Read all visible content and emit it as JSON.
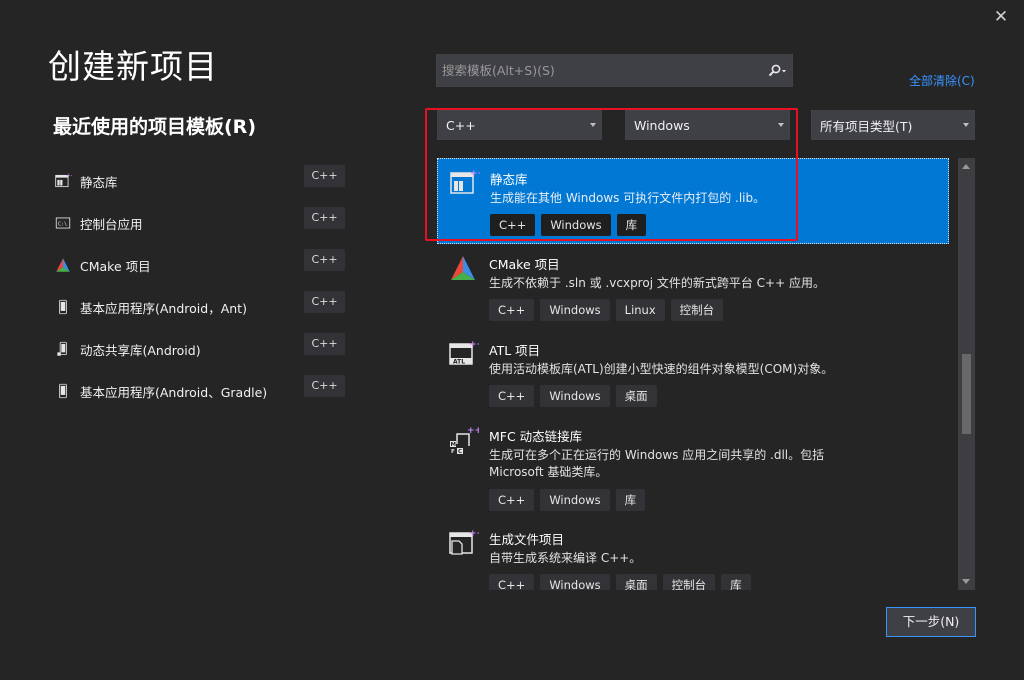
{
  "window": {
    "close_glyph": "✕"
  },
  "title": "创建新项目",
  "recent": {
    "title": "最近使用的项目模板(R)",
    "items": [
      {
        "icon": "static-library-icon",
        "label": "静态库",
        "tag": "C++"
      },
      {
        "icon": "console-app-icon",
        "label": "控制台应用",
        "tag": "C++"
      },
      {
        "icon": "cmake-icon",
        "label": "CMake 项目",
        "tag": "C++"
      },
      {
        "icon": "android-device-icon",
        "label": "基本应用程序(Android，Ant)",
        "tag": "C++"
      },
      {
        "icon": "android-shared-library-icon",
        "label": "动态共享库(Android)",
        "tag": "C++"
      },
      {
        "icon": "android-device-icon",
        "label": "基本应用程序(Android、Gradle)",
        "tag": "C++"
      }
    ]
  },
  "search": {
    "placeholder": "搜索模板(Alt+S)(S)",
    "value": ""
  },
  "clear_all": "全部清除(C)",
  "filters": {
    "language": "C++",
    "platform": "Windows",
    "project_type": "所有项目类型(T)"
  },
  "templates": [
    {
      "icon": "static-library-icon",
      "name": "静态库",
      "desc": "生成能在其他 Windows 可执行文件内打包的 .lib。",
      "tags": [
        "C++",
        "Windows",
        "库"
      ],
      "selected": true
    },
    {
      "icon": "cmake-icon",
      "name": "CMake 项目",
      "desc": "生成不依赖于 .sln 或 .vcxproj 文件的新式跨平台 C++ 应用。",
      "tags": [
        "C++",
        "Windows",
        "Linux",
        "控制台"
      ]
    },
    {
      "icon": "atl-icon",
      "name": "ATL 项目",
      "desc": "使用活动模板库(ATL)创建小型快速的组件对象模型(COM)对象。",
      "tags": [
        "C++",
        "Windows",
        "桌面"
      ]
    },
    {
      "icon": "mfc-icon",
      "name": "MFC 动态链接库",
      "desc": "生成可在多个正在运行的 Windows 应用之间共享的 .dll。包括 Microsoft 基础类库。",
      "tags": [
        "C++",
        "Windows",
        "库"
      ]
    },
    {
      "icon": "makefile-project-icon",
      "name": "生成文件项目",
      "desc": "自带生成系统来编译 C++。",
      "tags": [
        "C++",
        "Windows",
        "桌面",
        "控制台",
        "库"
      ]
    }
  ],
  "next_button": "下一步(N)",
  "colors": {
    "background": "#252526",
    "accent": "#0078d4",
    "link": "#3794ff",
    "highlight_border": "#e81123"
  }
}
